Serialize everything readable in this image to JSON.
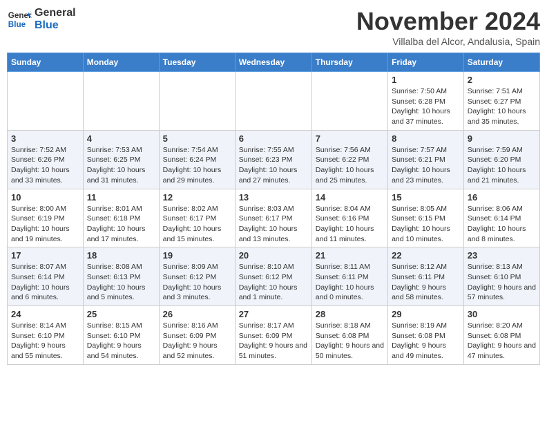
{
  "header": {
    "logo_line1": "General",
    "logo_line2": "Blue",
    "month_title": "November 2024",
    "location": "Villalba del Alcor, Andalusia, Spain"
  },
  "days_of_week": [
    "Sunday",
    "Monday",
    "Tuesday",
    "Wednesday",
    "Thursday",
    "Friday",
    "Saturday"
  ],
  "weeks": [
    [
      {
        "day": "",
        "info": ""
      },
      {
        "day": "",
        "info": ""
      },
      {
        "day": "",
        "info": ""
      },
      {
        "day": "",
        "info": ""
      },
      {
        "day": "",
        "info": ""
      },
      {
        "day": "1",
        "info": "Sunrise: 7:50 AM\nSunset: 6:28 PM\nDaylight: 10 hours and 37 minutes."
      },
      {
        "day": "2",
        "info": "Sunrise: 7:51 AM\nSunset: 6:27 PM\nDaylight: 10 hours and 35 minutes."
      }
    ],
    [
      {
        "day": "3",
        "info": "Sunrise: 7:52 AM\nSunset: 6:26 PM\nDaylight: 10 hours and 33 minutes."
      },
      {
        "day": "4",
        "info": "Sunrise: 7:53 AM\nSunset: 6:25 PM\nDaylight: 10 hours and 31 minutes."
      },
      {
        "day": "5",
        "info": "Sunrise: 7:54 AM\nSunset: 6:24 PM\nDaylight: 10 hours and 29 minutes."
      },
      {
        "day": "6",
        "info": "Sunrise: 7:55 AM\nSunset: 6:23 PM\nDaylight: 10 hours and 27 minutes."
      },
      {
        "day": "7",
        "info": "Sunrise: 7:56 AM\nSunset: 6:22 PM\nDaylight: 10 hours and 25 minutes."
      },
      {
        "day": "8",
        "info": "Sunrise: 7:57 AM\nSunset: 6:21 PM\nDaylight: 10 hours and 23 minutes."
      },
      {
        "day": "9",
        "info": "Sunrise: 7:59 AM\nSunset: 6:20 PM\nDaylight: 10 hours and 21 minutes."
      }
    ],
    [
      {
        "day": "10",
        "info": "Sunrise: 8:00 AM\nSunset: 6:19 PM\nDaylight: 10 hours and 19 minutes."
      },
      {
        "day": "11",
        "info": "Sunrise: 8:01 AM\nSunset: 6:18 PM\nDaylight: 10 hours and 17 minutes."
      },
      {
        "day": "12",
        "info": "Sunrise: 8:02 AM\nSunset: 6:17 PM\nDaylight: 10 hours and 15 minutes."
      },
      {
        "day": "13",
        "info": "Sunrise: 8:03 AM\nSunset: 6:17 PM\nDaylight: 10 hours and 13 minutes."
      },
      {
        "day": "14",
        "info": "Sunrise: 8:04 AM\nSunset: 6:16 PM\nDaylight: 10 hours and 11 minutes."
      },
      {
        "day": "15",
        "info": "Sunrise: 8:05 AM\nSunset: 6:15 PM\nDaylight: 10 hours and 10 minutes."
      },
      {
        "day": "16",
        "info": "Sunrise: 8:06 AM\nSunset: 6:14 PM\nDaylight: 10 hours and 8 minutes."
      }
    ],
    [
      {
        "day": "17",
        "info": "Sunrise: 8:07 AM\nSunset: 6:14 PM\nDaylight: 10 hours and 6 minutes."
      },
      {
        "day": "18",
        "info": "Sunrise: 8:08 AM\nSunset: 6:13 PM\nDaylight: 10 hours and 5 minutes."
      },
      {
        "day": "19",
        "info": "Sunrise: 8:09 AM\nSunset: 6:12 PM\nDaylight: 10 hours and 3 minutes."
      },
      {
        "day": "20",
        "info": "Sunrise: 8:10 AM\nSunset: 6:12 PM\nDaylight: 10 hours and 1 minute."
      },
      {
        "day": "21",
        "info": "Sunrise: 8:11 AM\nSunset: 6:11 PM\nDaylight: 10 hours and 0 minutes."
      },
      {
        "day": "22",
        "info": "Sunrise: 8:12 AM\nSunset: 6:11 PM\nDaylight: 9 hours and 58 minutes."
      },
      {
        "day": "23",
        "info": "Sunrise: 8:13 AM\nSunset: 6:10 PM\nDaylight: 9 hours and 57 minutes."
      }
    ],
    [
      {
        "day": "24",
        "info": "Sunrise: 8:14 AM\nSunset: 6:10 PM\nDaylight: 9 hours and 55 minutes."
      },
      {
        "day": "25",
        "info": "Sunrise: 8:15 AM\nSunset: 6:10 PM\nDaylight: 9 hours and 54 minutes."
      },
      {
        "day": "26",
        "info": "Sunrise: 8:16 AM\nSunset: 6:09 PM\nDaylight: 9 hours and 52 minutes."
      },
      {
        "day": "27",
        "info": "Sunrise: 8:17 AM\nSunset: 6:09 PM\nDaylight: 9 hours and 51 minutes."
      },
      {
        "day": "28",
        "info": "Sunrise: 8:18 AM\nSunset: 6:08 PM\nDaylight: 9 hours and 50 minutes."
      },
      {
        "day": "29",
        "info": "Sunrise: 8:19 AM\nSunset: 6:08 PM\nDaylight: 9 hours and 49 minutes."
      },
      {
        "day": "30",
        "info": "Sunrise: 8:20 AM\nSunset: 6:08 PM\nDaylight: 9 hours and 47 minutes."
      }
    ]
  ]
}
